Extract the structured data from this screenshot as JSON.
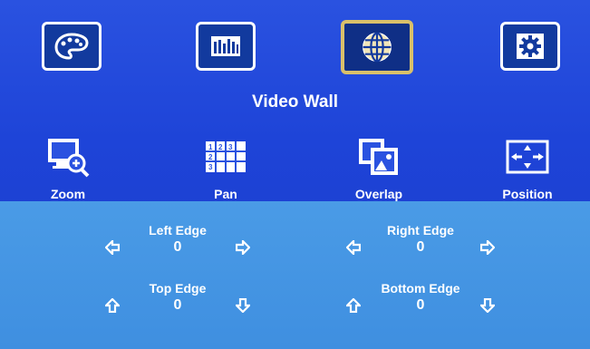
{
  "top_menu": [
    {
      "icon": "palette-icon"
    },
    {
      "icon": "equalizer-icon"
    },
    {
      "icon": "globe-icon",
      "selected": true
    },
    {
      "icon": "gear-icon"
    }
  ],
  "title": "Video Wall",
  "sub_menu": [
    {
      "label": "Zoom",
      "icon": "zoom-monitor-icon"
    },
    {
      "label": "Pan",
      "icon": "grid-icon"
    },
    {
      "label": "Overlap",
      "icon": "photo-overlap-icon"
    },
    {
      "label": "Position",
      "icon": "position-arrows-icon"
    }
  ],
  "controls": {
    "left_edge": {
      "label": "Left Edge",
      "value": "0"
    },
    "right_edge": {
      "label": "Right Edge",
      "value": "0"
    },
    "top_edge": {
      "label": "Top Edge",
      "value": "0"
    },
    "bottom_edge": {
      "label": "Bottom Edge",
      "value": "0"
    }
  },
  "colors": {
    "background": "#1e44d8",
    "panel": "#4394e2",
    "selected_border": "#d9c06a"
  }
}
